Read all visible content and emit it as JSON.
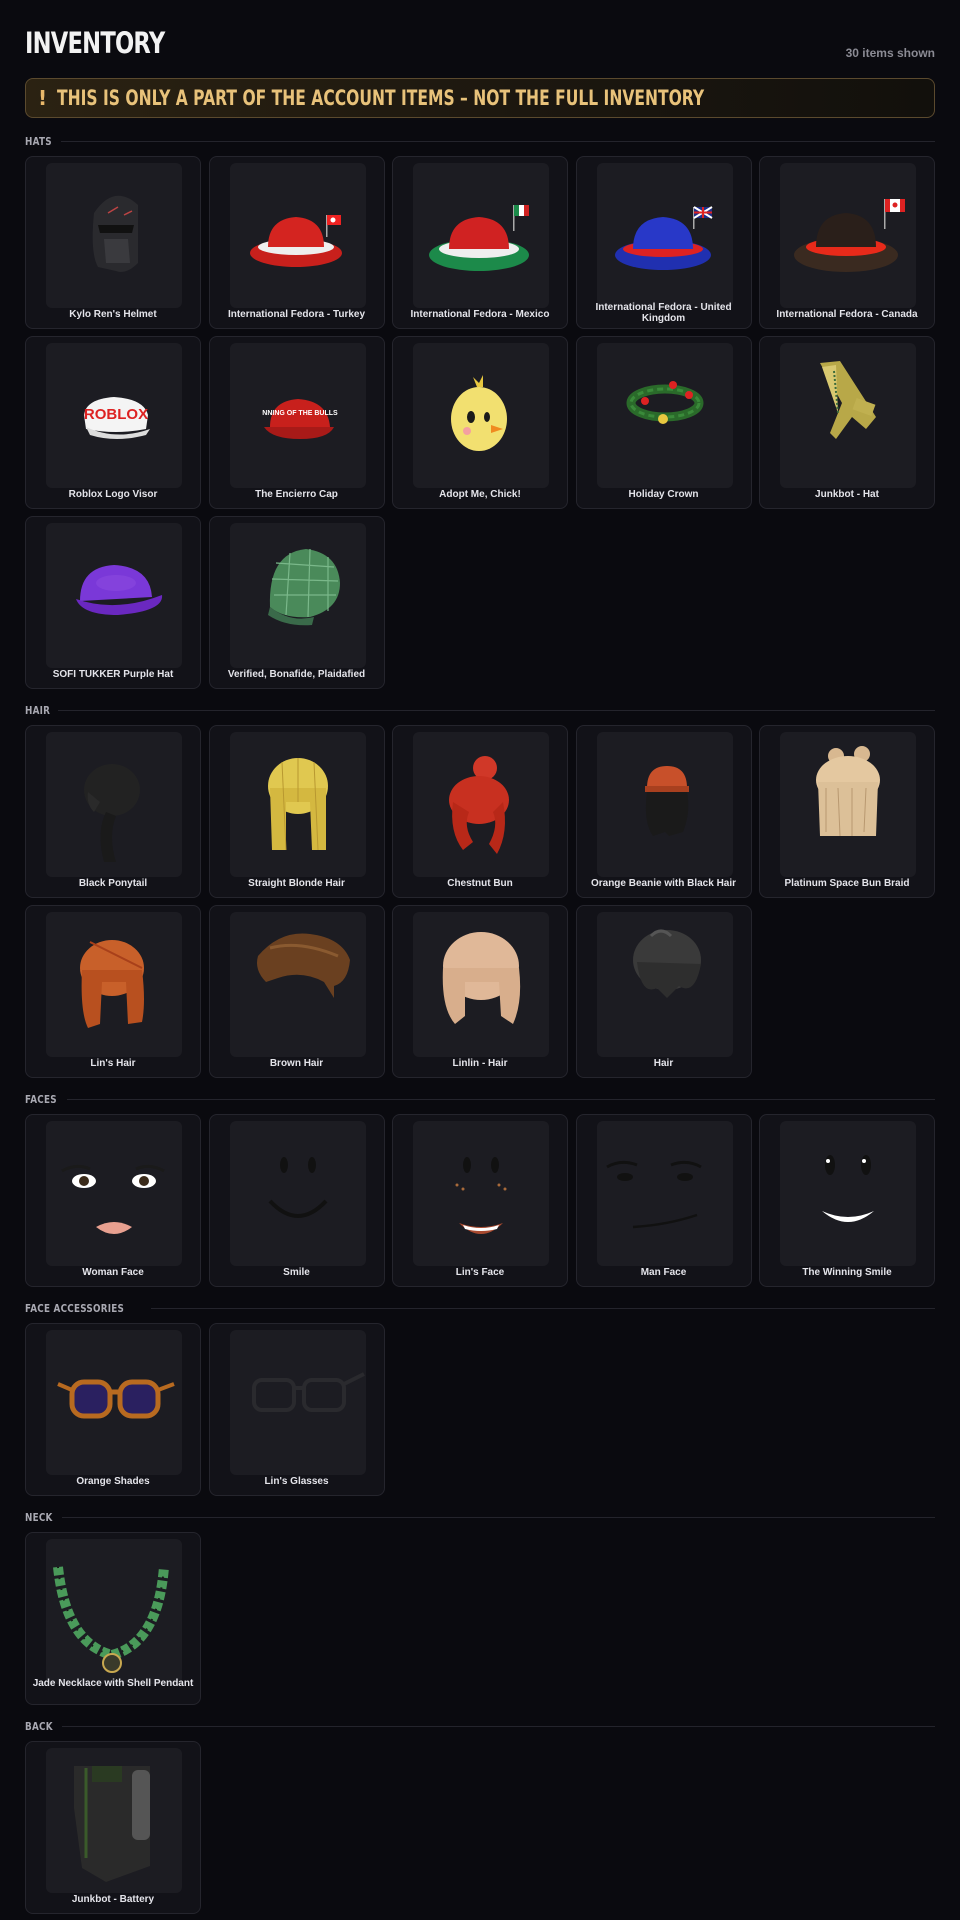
{
  "header": {
    "title": "INVENTORY",
    "count": "30 items shown"
  },
  "banner": {
    "icon": "!",
    "text": "THIS IS ONLY A PART OF THE ACCOUNT ITEMS – NOT THE FULL INVENTORY"
  },
  "sections": [
    {
      "title": "HATS",
      "items": [
        {
          "name": "Kylo Ren's Helmet",
          "icon": "helmet-icon"
        },
        {
          "name": "International Fedora - Turkey",
          "icon": "fedora-turkey-icon"
        },
        {
          "name": "International Fedora - Mexico",
          "icon": "fedora-mexico-icon"
        },
        {
          "name": "International Fedora - United Kingdom",
          "icon": "fedora-uk-icon"
        },
        {
          "name": "International Fedora - Canada",
          "icon": "fedora-canada-icon"
        },
        {
          "name": "Roblox Logo Visor",
          "icon": "visor-icon",
          "print": "ROBLOX"
        },
        {
          "name": "The Encierro Cap",
          "icon": "cap-icon",
          "print": "NNING OF THE BULLS"
        },
        {
          "name": "Adopt Me, Chick!",
          "icon": "chick-icon"
        },
        {
          "name": "Holiday Crown",
          "icon": "wreath-icon"
        },
        {
          "name": "Junkbot - Hat",
          "icon": "junkbot-hat-icon"
        },
        {
          "name": "SOFI TUKKER Purple Hat",
          "icon": "purple-cap-icon"
        },
        {
          "name": "Verified, Bonafide, Plaidafied",
          "icon": "plaid-cap-icon"
        }
      ]
    },
    {
      "title": "HAIR",
      "items": [
        {
          "name": "Black Ponytail",
          "icon": "black-ponytail-icon"
        },
        {
          "name": "Straight Blonde Hair",
          "icon": "blonde-hair-icon"
        },
        {
          "name": "Chestnut Bun",
          "icon": "chestnut-bun-icon"
        },
        {
          "name": "Orange Beanie with Black Hair",
          "icon": "beanie-hair-icon"
        },
        {
          "name": "Platinum Space Bun Braid",
          "icon": "platinum-hair-icon"
        },
        {
          "name": "Lin's Hair",
          "icon": "lin-hair-icon"
        },
        {
          "name": "Brown Hair",
          "icon": "brown-hair-icon"
        },
        {
          "name": "Linlin - Hair",
          "icon": "linlin-hair-icon"
        },
        {
          "name": "Hair",
          "icon": "dark-hair-icon"
        }
      ]
    },
    {
      "title": "FACES",
      "items": [
        {
          "name": "Woman Face",
          "icon": "woman-face-icon"
        },
        {
          "name": "Smile",
          "icon": "smile-face-icon"
        },
        {
          "name": "Lin's Face",
          "icon": "lin-face-icon"
        },
        {
          "name": "Man Face",
          "icon": "man-face-icon"
        },
        {
          "name": "The Winning Smile",
          "icon": "winning-smile-icon"
        }
      ]
    },
    {
      "title": "FACE ACCESSORIES",
      "items": [
        {
          "name": "Orange Shades",
          "icon": "orange-shades-icon"
        },
        {
          "name": "Lin's Glasses",
          "icon": "glasses-icon"
        }
      ]
    },
    {
      "title": "NECK",
      "items": [
        {
          "name": "Jade Necklace with Shell Pendant",
          "icon": "necklace-icon"
        }
      ]
    },
    {
      "title": "BACK",
      "items": [
        {
          "name": "Junkbot - Battery",
          "icon": "battery-icon"
        }
      ]
    }
  ]
}
